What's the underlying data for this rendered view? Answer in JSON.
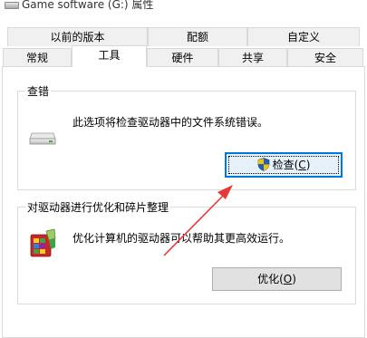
{
  "window": {
    "title": "Game software (G:) 属性"
  },
  "tabs": {
    "row1": [
      "以前的版本",
      "配额",
      "自定义"
    ],
    "row2": [
      "常规",
      "工具",
      "硬件",
      "共享",
      "安全"
    ],
    "active": "工具"
  },
  "error_checking": {
    "group_title": "查错",
    "description": "此选项将检查驱动器中的文件系统错误。",
    "button_label": "检查(",
    "button_key": "C",
    "button_close": ")",
    "icon": "drive-icon"
  },
  "optimize": {
    "group_title": "对驱动器进行优化和碎片整理",
    "description": "优化计算机的驱动器可以帮助其更高效运行。",
    "button_label": "优化(",
    "button_key": "O",
    "button_close": ")",
    "icon": "defrag-icon"
  },
  "colors": {
    "focus_border": "#0078d7",
    "annotation_arrow": "#e53935"
  }
}
